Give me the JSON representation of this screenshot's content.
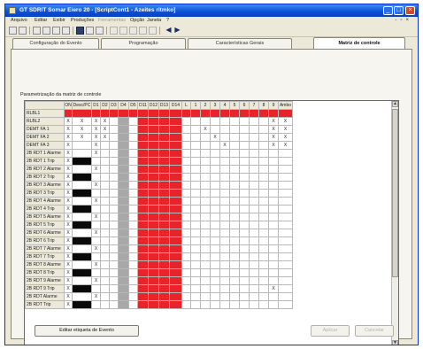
{
  "window": {
    "title": "GT SDRIT Somar Eiero 20 - [ScriptCont1 - Azeites ritmko]"
  },
  "menu": [
    "Arquivo",
    "Editar",
    "Exibir",
    "Produções",
    "Ferramentas",
    "Opção",
    "Janela",
    "?"
  ],
  "tabs": [
    "Configuração do Evento",
    "Programação",
    "Características Gerais",
    "Matriz de controle"
  ],
  "active_tab": 3,
  "group_label": "Parametrização da matriz de controle",
  "columns": [
    "",
    "ON",
    "Desc/PC",
    "D1",
    "D2",
    "D3",
    "D4",
    "D5",
    "D11",
    "D12",
    "D13",
    "D14",
    "L",
    "1",
    "2",
    "3",
    "4",
    "5",
    "6",
    "7",
    "8",
    "9",
    "Ambo"
  ],
  "rows": [
    {
      "label": "RLBL1",
      "cells": [
        "",
        "",
        "",
        "",
        "",
        "",
        "",
        "",
        "",
        "",
        "",
        "",
        "",
        "",
        "",
        "",
        "",
        "",
        "",
        "",
        "",
        ""
      ]
    },
    {
      "label": "RLBL2",
      "cells": [
        "X",
        "X",
        "X",
        "X",
        "",
        "",
        "",
        "",
        "",
        "",
        "",
        "",
        "",
        "",
        "",
        "",
        "",
        "",
        "",
        "",
        "X",
        "X"
      ]
    },
    {
      "label": "DEMT FA 1",
      "cells": [
        "X",
        "X",
        "X",
        "X",
        "",
        "",
        "",
        "",
        "",
        "",
        "",
        "",
        "",
        "X",
        "",
        "",
        "",
        "",
        "",
        "",
        "X",
        "X"
      ]
    },
    {
      "label": "DEMT FA 2",
      "cells": [
        "X",
        "X",
        "X",
        "X",
        "",
        "",
        "",
        "",
        "",
        "",
        "",
        "",
        "",
        "",
        "X",
        "",
        "",
        "",
        "",
        "",
        "X",
        "X"
      ]
    },
    {
      "label": "DEMT FA 3",
      "cells": [
        "X",
        "",
        "X",
        "",
        "",
        "",
        "",
        "",
        "",
        "",
        "",
        "",
        "",
        "",
        "",
        "X",
        "",
        "",
        "",
        "",
        "X",
        "X"
      ]
    },
    {
      "label": "2B RDT 1 Alarme",
      "cells": [
        "X",
        "",
        "X",
        "",
        "",
        "",
        "",
        "",
        "",
        "",
        "",
        "",
        "",
        "",
        "",
        "",
        "",
        "",
        "",
        "",
        "",
        ""
      ]
    },
    {
      "label": "2B RDT 1 Trip",
      "cells": [
        "X",
        "",
        "",
        "",
        "",
        "",
        "",
        "",
        "",
        "",
        "",
        "",
        "",
        "",
        "",
        "",
        "",
        "",
        "",
        "",
        "",
        ""
      ]
    },
    {
      "label": "2B RDT 2 Alarme",
      "cells": [
        "X",
        "",
        "X",
        "",
        "",
        "",
        "",
        "",
        "",
        "",
        "",
        "",
        "",
        "",
        "",
        "",
        "",
        "",
        "",
        "",
        "",
        ""
      ]
    },
    {
      "label": "2B RDT 2 Trip",
      "cells": [
        "X",
        "",
        "",
        "",
        "",
        "",
        "",
        "",
        "",
        "",
        "",
        "",
        "",
        "",
        "",
        "",
        "",
        "",
        "",
        "",
        "",
        ""
      ]
    },
    {
      "label": "2B RDT 3 Alarme",
      "cells": [
        "X",
        "",
        "X",
        "",
        "",
        "",
        "",
        "",
        "",
        "",
        "",
        "",
        "",
        "",
        "",
        "",
        "",
        "",
        "",
        "",
        "",
        ""
      ]
    },
    {
      "label": "2B RDT 3 Trip",
      "cells": [
        "X",
        "",
        "",
        "",
        "",
        "",
        "",
        "",
        "",
        "",
        "",
        "",
        "",
        "",
        "",
        "",
        "",
        "",
        "",
        "",
        "",
        ""
      ]
    },
    {
      "label": "2B RDT 4 Alarme",
      "cells": [
        "X",
        "",
        "X",
        "",
        "",
        "",
        "",
        "",
        "",
        "",
        "",
        "",
        "",
        "",
        "",
        "",
        "",
        "",
        "",
        "",
        "",
        ""
      ]
    },
    {
      "label": "2B RDT 4 Trip",
      "cells": [
        "X",
        "",
        "",
        "",
        "",
        "",
        "",
        "",
        "",
        "",
        "",
        "",
        "",
        "",
        "",
        "",
        "",
        "",
        "",
        "",
        "",
        ""
      ]
    },
    {
      "label": "2B RDT 5 Alarme",
      "cells": [
        "X",
        "",
        "X",
        "",
        "",
        "",
        "",
        "",
        "",
        "",
        "",
        "",
        "",
        "",
        "",
        "",
        "",
        "",
        "",
        "",
        "",
        ""
      ]
    },
    {
      "label": "2B RDT 5 Trip",
      "cells": [
        "X",
        "",
        "",
        "",
        "",
        "",
        "",
        "",
        "",
        "",
        "",
        "",
        "",
        "",
        "",
        "",
        "",
        "",
        "",
        "",
        "",
        ""
      ]
    },
    {
      "label": "2B RDT 6 Alarme",
      "cells": [
        "X",
        "",
        "X",
        "",
        "",
        "",
        "",
        "",
        "",
        "",
        "",
        "",
        "",
        "",
        "",
        "",
        "",
        "",
        "",
        "",
        "",
        ""
      ]
    },
    {
      "label": "2B RDT 6 Trip",
      "cells": [
        "X",
        "",
        "",
        "",
        "",
        "",
        "",
        "",
        "",
        "",
        "",
        "",
        "",
        "",
        "",
        "",
        "",
        "",
        "",
        "",
        "",
        ""
      ]
    },
    {
      "label": "2B RDT 7 Alarme",
      "cells": [
        "X",
        "",
        "X",
        "",
        "",
        "",
        "",
        "",
        "",
        "",
        "",
        "",
        "",
        "",
        "",
        "",
        "",
        "",
        "",
        "",
        "",
        ""
      ]
    },
    {
      "label": "2B RDT 7 Trip",
      "cells": [
        "X",
        "",
        "",
        "",
        "",
        "",
        "",
        "",
        "",
        "",
        "",
        "",
        "",
        "",
        "",
        "",
        "",
        "",
        "",
        "",
        "",
        ""
      ]
    },
    {
      "label": "2B RDT 8 Alarme",
      "cells": [
        "X",
        "",
        "X",
        "",
        "",
        "",
        "",
        "",
        "",
        "",
        "",
        "",
        "",
        "",
        "",
        "",
        "",
        "",
        "",
        "",
        "",
        ""
      ]
    },
    {
      "label": "2B RDT 8 Trip",
      "cells": [
        "X",
        "",
        "",
        "",
        "",
        "",
        "",
        "",
        "",
        "",
        "",
        "",
        "",
        "",
        "",
        "",
        "",
        "",
        "",
        "",
        "",
        ""
      ]
    },
    {
      "label": "2B RDT 9 Alarme",
      "cells": [
        "X",
        "",
        "X",
        "",
        "",
        "",
        "",
        "",
        "",
        "",
        "",
        "",
        "",
        "",
        "",
        "",
        "",
        "",
        "",
        "",
        "",
        ""
      ]
    },
    {
      "label": "2B RDT 9 Trip",
      "cells": [
        "X",
        "",
        "",
        "",
        "",
        "",
        "",
        "",
        "",
        "",
        "",
        "",
        "",
        "",
        "",
        "",
        "",
        "",
        "",
        "",
        "X",
        ""
      ]
    },
    {
      "label": "2B RDT Alarme",
      "cells": [
        "X",
        "",
        "X",
        "",
        "",
        "",
        "",
        "",
        "",
        "",
        "",
        "",
        "",
        "",
        "",
        "",
        "",
        "",
        "",
        "",
        "",
        ""
      ]
    },
    {
      "label": "2B RDT Trip",
      "cells": [
        "X",
        "",
        "",
        "",
        "",
        "",
        "",
        "",
        "",
        "",
        "",
        "",
        "",
        "",
        "",
        "",
        "",
        "",
        "",
        "",
        "",
        ""
      ]
    }
  ],
  "buttons": {
    "edit_label": "Editar etiqueta de Evento",
    "apply": "Aplicar",
    "cancel": "Cancelar"
  },
  "colors": {
    "accent_red": "#e8242a",
    "black_block": "#0a0a0a",
    "gray_column": "#a8a8a8",
    "titlebar": "#0a4fd6"
  },
  "icons": [
    "app-icon",
    "new-icon",
    "open-icon",
    "save-icon",
    "print-icon",
    "cut-icon",
    "copy-icon",
    "paste-icon",
    "undo-icon",
    "prev-arrow-icon",
    "next-arrow-icon"
  ]
}
